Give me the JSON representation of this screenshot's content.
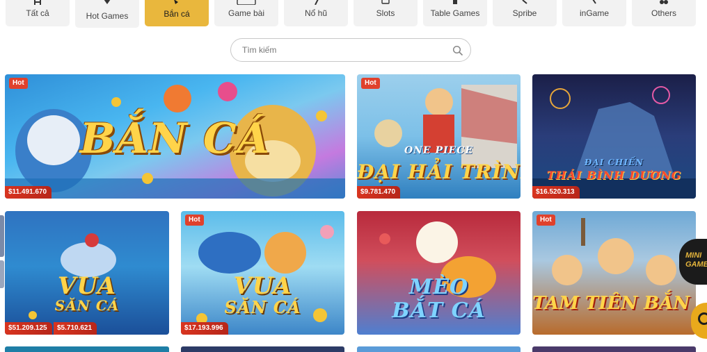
{
  "categories": [
    {
      "label": "Tất cả",
      "icon": "all-icon",
      "active": false
    },
    {
      "label": "Hot Games",
      "icon": "diamond-icon",
      "active": false
    },
    {
      "label": "Bắn cá",
      "icon": "fish-icon",
      "active": true
    },
    {
      "label": "Game bài",
      "icon": "cards-icon",
      "active": false
    },
    {
      "label": "Nổ hũ",
      "icon": "jackpot-icon",
      "active": false
    },
    {
      "label": "Slots",
      "icon": "slots-icon",
      "active": false
    },
    {
      "label": "Table Games",
      "icon": "table-icon",
      "active": false
    },
    {
      "label": "Spribe",
      "icon": "spribe-icon",
      "active": false
    },
    {
      "label": "inGame",
      "icon": "ingame-icon",
      "active": false
    },
    {
      "label": "Others",
      "icon": "others-icon",
      "active": false
    }
  ],
  "search": {
    "placeholder": "Tìm kiếm",
    "value": ""
  },
  "games": [
    {
      "title": "BẮN CÁ",
      "badge": "Hot",
      "jackpots": [
        "$11.491.670"
      ]
    },
    {
      "title_top": "ONE PIECE",
      "title": "ĐẠI HẢI TRÌNH",
      "badge": "Hot",
      "jackpots": [
        "$9.781.470"
      ]
    },
    {
      "title_top": "ĐẠI CHIẾN",
      "title": "THÁI BÌNH DƯƠNG",
      "badge": "",
      "jackpots": [
        "$16.520.313"
      ]
    },
    {
      "title_top": "VUA",
      "title": "SĂN CÁ",
      "badge": "",
      "jackpots": [
        "$51.209.125",
        "$5.710.621"
      ]
    },
    {
      "title_top": "VUA",
      "title": "SĂN CÁ",
      "badge": "Hot",
      "jackpots": [
        "$17.193.996"
      ]
    },
    {
      "title_top": "MÈO",
      "title": "BẮT CÁ",
      "badge": "",
      "jackpots": []
    },
    {
      "title": "TAM TIÊN BẮN CÁ",
      "badge": "Hot",
      "jackpots": []
    }
  ],
  "badges": {
    "provider": "MINI GAME"
  },
  "colors": {
    "accent": "#e9b73d",
    "hot": "#e0412c",
    "jackpot": "#d8341f"
  }
}
